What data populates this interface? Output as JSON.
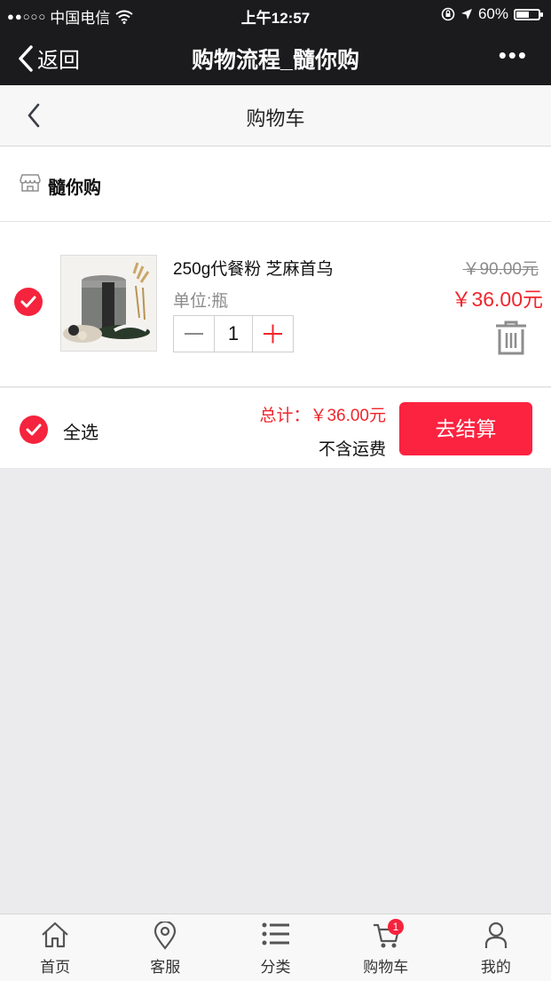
{
  "status_bar": {
    "carrier": "中国电信",
    "time": "上午12:57",
    "battery_percent": "60%",
    "battery_level": 0.6
  },
  "wechat_nav": {
    "back_label": "返回",
    "title": "购物流程_髓你购",
    "more_label": "•••"
  },
  "header": {
    "title": "购物车"
  },
  "shop": {
    "name": "髓你购",
    "icon": "store-icon"
  },
  "cart_items": [
    {
      "name": "250g代餐粉 芝麻首乌",
      "unit": "单位:瓶",
      "quantity": "1",
      "original_price": "￥90.00元",
      "price": "￥36.00元",
      "checked": true
    }
  ],
  "footer": {
    "select_all_label": "全选",
    "total": "总计：￥36.00元",
    "shipping_note": "不含运费",
    "checkout_label": "去结算"
  },
  "tabbar": {
    "items": [
      {
        "label": "首页",
        "icon": "home-icon"
      },
      {
        "label": "客服",
        "icon": "location-pin-icon"
      },
      {
        "label": "分类",
        "icon": "list-icon"
      },
      {
        "label": "购物车",
        "icon": "cart-icon"
      },
      {
        "label": "我的",
        "icon": "user-icon"
      }
    ],
    "cart_badge": "1"
  },
  "colors": {
    "accent": "#f5233d",
    "price": "#f0262c",
    "nav_bg": "#1b1b1d",
    "page_bg": "#ebebed"
  }
}
